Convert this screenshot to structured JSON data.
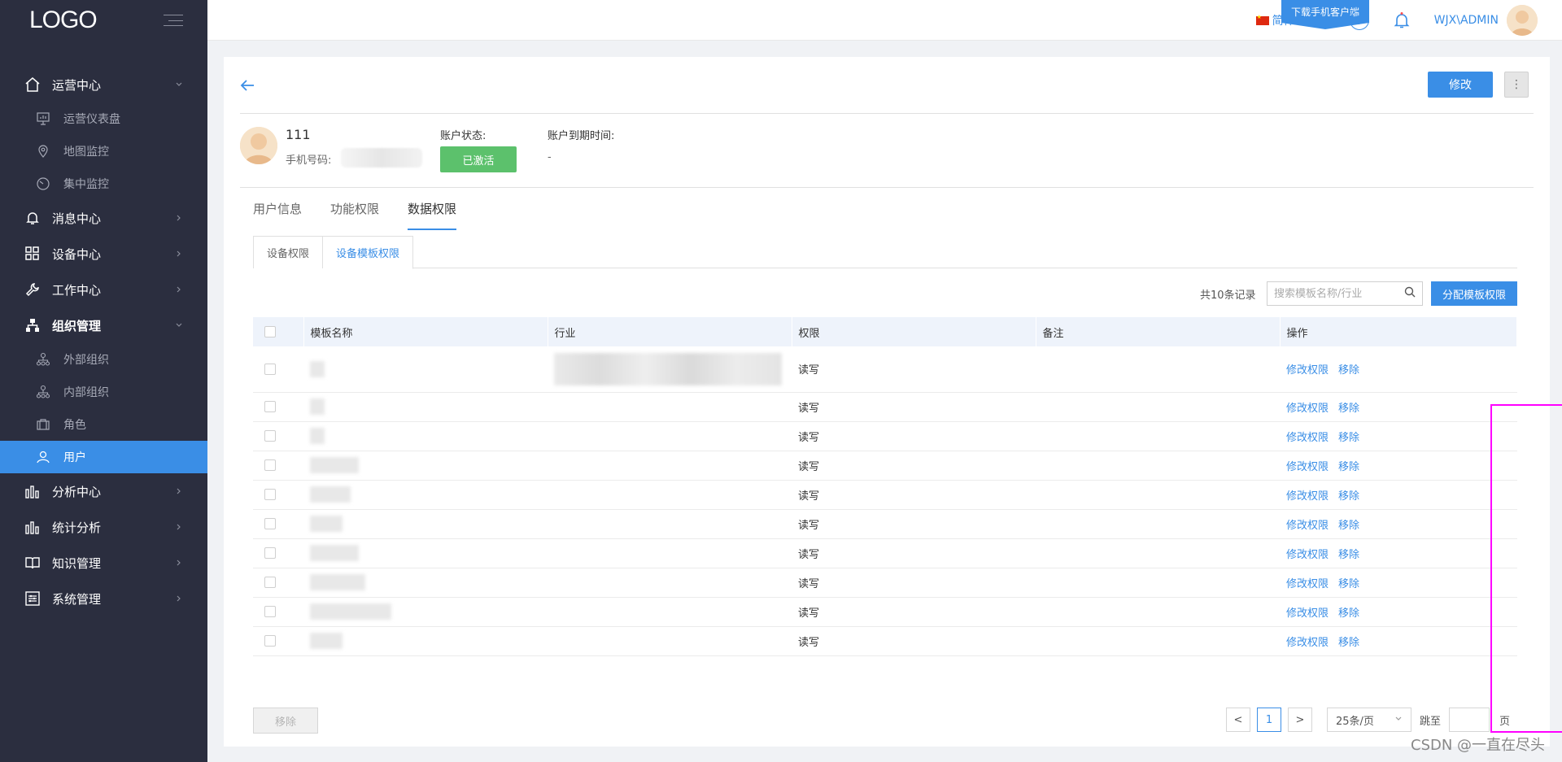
{
  "sidebar": {
    "logo": "LOGO",
    "items": [
      {
        "label": "运营中心",
        "icon": "home-icon",
        "expanded": true
      },
      {
        "label": "运营仪表盘",
        "icon": "dashboard-icon",
        "sub": true
      },
      {
        "label": "地图监控",
        "icon": "map-pin-icon",
        "sub": true
      },
      {
        "label": "集中监控",
        "icon": "clock-icon",
        "sub": true
      },
      {
        "label": "消息中心",
        "icon": "bell-icon"
      },
      {
        "label": "设备中心",
        "icon": "grid-icon"
      },
      {
        "label": "工作中心",
        "icon": "wrench-icon"
      },
      {
        "label": "组织管理",
        "icon": "org-chart-icon",
        "expanded": true
      },
      {
        "label": "外部组织",
        "icon": "org-icon",
        "sub": true
      },
      {
        "label": "内部组织",
        "icon": "org-icon",
        "sub": true
      },
      {
        "label": "角色",
        "icon": "briefcase-icon",
        "sub": true
      },
      {
        "label": "用户",
        "icon": "user-icon",
        "sub": true,
        "active": true
      },
      {
        "label": "分析中心",
        "icon": "bar-chart-icon"
      },
      {
        "label": "统计分析",
        "icon": "bar-chart-icon"
      },
      {
        "label": "知识管理",
        "icon": "book-icon"
      },
      {
        "label": "系统管理",
        "icon": "settings-panel-icon"
      }
    ]
  },
  "topbar": {
    "download_label": "下载手机客户端",
    "language": "简体中文",
    "help_glyph": "?",
    "username": "WJX\\ADMIN"
  },
  "header": {
    "edit_label": "修改",
    "more_glyph": "⋮"
  },
  "user": {
    "name": "111",
    "phone_label": "手机号码:",
    "status_label": "账户状态:",
    "status_value": "已激活",
    "expire_label": "账户到期时间:",
    "expire_value": "-"
  },
  "tabs": [
    "用户信息",
    "功能权限",
    "数据权限"
  ],
  "subtabs": [
    "设备权限",
    "设备模板权限"
  ],
  "toolbar": {
    "record_count": "共10条记录",
    "search_placeholder": "搜索模板名称/行业",
    "assign_label": "分配模板权限"
  },
  "table": {
    "columns": [
      "模板名称",
      "行业",
      "权限",
      "备注",
      "操作"
    ],
    "rows": [
      {
        "permission": "读写",
        "note": ""
      },
      {
        "permission": "读写",
        "note": ""
      },
      {
        "permission": "读写",
        "note": ""
      },
      {
        "permission": "读写",
        "note": ""
      },
      {
        "permission": "读写",
        "note": ""
      },
      {
        "permission": "读写",
        "note": ""
      },
      {
        "permission": "读写",
        "note": ""
      },
      {
        "permission": "读写",
        "note": ""
      },
      {
        "permission": "读写",
        "note": ""
      },
      {
        "permission": "读写",
        "note": ""
      }
    ],
    "action_edit": "修改权限",
    "action_remove": "移除"
  },
  "footer": {
    "remove_label": "移除",
    "prev_glyph": "<",
    "next_glyph": ">",
    "current_page": "1",
    "page_size": "25条/页",
    "jump_label": "跳至",
    "page_unit": "页"
  },
  "watermark": "CSDN @一直在尽头",
  "colors": {
    "sidebar_bg": "#2b2e3f",
    "accent": "#3a8ee6",
    "status_green": "#5cc16c",
    "highlight": "#ff00ff"
  }
}
